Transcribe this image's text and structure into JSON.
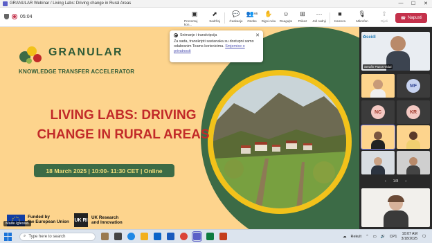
{
  "window": {
    "title": "GRANULAR Webinar / Living Labs: Driving change in Rural Areas",
    "controls": [
      "—",
      "☐",
      "✕"
    ]
  },
  "meeting": {
    "timer": "05:04",
    "toolbar": [
      {
        "label": "Prezentuj kon...",
        "icon": "share-screen-icon"
      },
      {
        "label": "Sadržaj",
        "icon": "share-content-icon"
      },
      {
        "label": "Ćaskanje",
        "icon": "chat-icon"
      },
      {
        "label": "Osobe",
        "icon": "people-icon",
        "badge": "66"
      },
      {
        "label": "Digni ruku",
        "icon": "raise-hand-icon"
      },
      {
        "label": "Reagujte",
        "icon": "react-icon"
      },
      {
        "label": "Prikaz",
        "icon": "view-grid-icon"
      },
      {
        "label": "Još radnji",
        "icon": "more-icon"
      },
      {
        "label": "Kamera",
        "icon": "camera-icon"
      },
      {
        "label": "Mikrofon",
        "icon": "mic-off-icon"
      },
      {
        "label": "Dijeli",
        "icon": "share-icon"
      }
    ],
    "leave_label": "Napusti"
  },
  "toast": {
    "title": "Snimanje i transkripcija",
    "body": "Za sada, transkripti sastanaka su dostupni samo odabranim Teams korisnicima.",
    "link": "Smjernice o privatnosti"
  },
  "slide": {
    "brand": "GRANULAR",
    "brand_sub": "KNOWLEDGE TRANSFER ACCELERATOR",
    "headline_line1": "LIVING LABS: DRIVING",
    "headline_line2": "CHANGE IN RURAL AREAS",
    "date": "18 March 2025 | 10:00- 11:30 CET | Online",
    "eu_line1": "Funded by",
    "eu_line2": "the European Union",
    "uk_logo": "UK RI",
    "uk_line1": "UK Research",
    "uk_line2": "and Innovation",
    "presenter_caption": "Maite Iglesias",
    "colors": {
      "background": "#fdd48d",
      "accent_green": "#3c6b46",
      "headline": "#c22a29",
      "ring": "#f2c21a"
    }
  },
  "participants": {
    "main_caption": "Serafin Pazos-Vidal",
    "tiles": [
      {
        "initials": "MF",
        "color": "#c7d3f0",
        "text_color": "#3b4f9a"
      },
      {
        "initials": "NC",
        "color": "#f4c9c3",
        "text_color": "#a03a2c"
      },
      {
        "initials": "KR",
        "color": "#f4c9c3",
        "text_color": "#a03a2c"
      }
    ],
    "page": "1/8"
  },
  "taskbar": {
    "search_placeholder": "Type here to search",
    "weather": "Rekult",
    "lang": "CP1",
    "time": "10:07 AM",
    "date": "3/18/2025"
  }
}
